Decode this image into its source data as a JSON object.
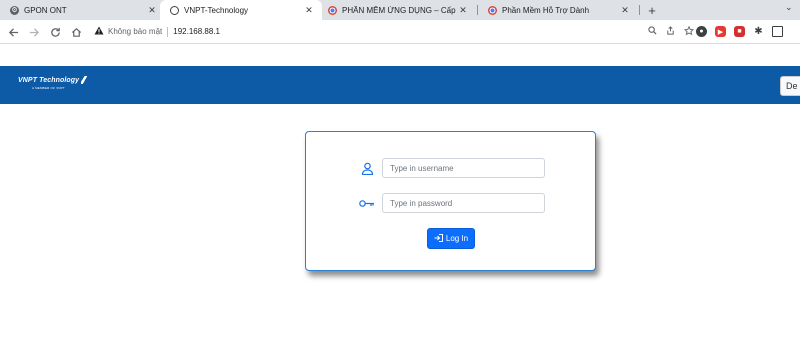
{
  "browser": {
    "tabs": [
      {
        "title": "GPON ONT",
        "favicon": "globe-gear-icon"
      },
      {
        "title": "VNPT-Technology",
        "favicon": "globe-icon",
        "active": true
      },
      {
        "title": "PHẦN MỀM ỨNG DỤNG – Cấp C",
        "favicon": "chrome-icon"
      },
      {
        "title": "Phần Mềm Hỗ Trợ Dành",
        "favicon": "chrome-icon"
      }
    ],
    "close_glyph": "✕",
    "new_tab_glyph": "+",
    "tab_search_glyph": "⌄",
    "address": {
      "security_label": "Không bảo mật",
      "url": "192.168.88.1"
    }
  },
  "page": {
    "brand": "VNPT Technology",
    "brand_tagline": "A MEMBER OF VNPT",
    "language_button": "De",
    "login": {
      "username_placeholder": "Type in username",
      "password_placeholder": "Type in password",
      "button_label": "Log In"
    }
  },
  "colors": {
    "banner": "#0d5aa7",
    "primary_button": "#0d6efd",
    "card_border": "#2d7fd3"
  }
}
